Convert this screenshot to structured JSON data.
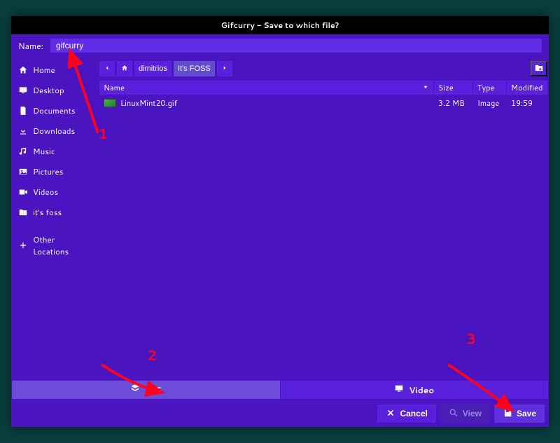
{
  "title": "Gifcurry - Save to which file?",
  "name_label": "Name:",
  "name_value": "gifcurry",
  "sidebar": {
    "items": [
      {
        "label": "Home"
      },
      {
        "label": "Desktop"
      },
      {
        "label": "Documents"
      },
      {
        "label": "Downloads"
      },
      {
        "label": "Music"
      },
      {
        "label": "Pictures"
      },
      {
        "label": "Videos"
      },
      {
        "label": "it's foss"
      },
      {
        "label": "Other Locations"
      }
    ]
  },
  "path": {
    "segments": [
      {
        "label": "dimitrios"
      },
      {
        "label": "It's FOSS"
      }
    ]
  },
  "columns": {
    "name": "Name",
    "size": "Size",
    "type": "Type",
    "modified": "Modified"
  },
  "files": [
    {
      "name": "LinuxMint20.gif",
      "size": "3.2 MB",
      "type": "Image",
      "modified": "19:59"
    }
  ],
  "toggle": {
    "gif": "GIF",
    "video": "Video"
  },
  "actions": {
    "cancel": "Cancel",
    "view": "View",
    "save": "Save"
  },
  "annotations": [
    "1",
    "2",
    "3"
  ]
}
